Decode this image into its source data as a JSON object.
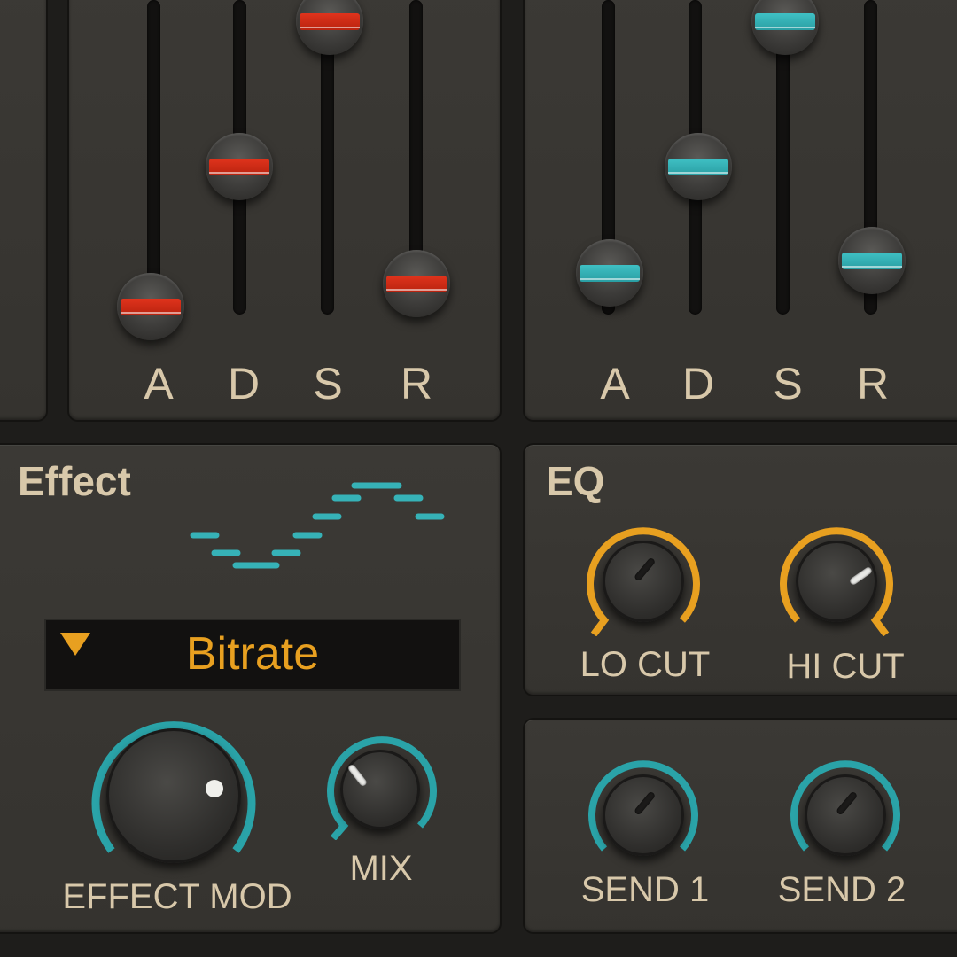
{
  "accent": {
    "env1": "#d9301a",
    "env2": "#36b2b7",
    "eq": "#e8a020",
    "effect_knob": "#2aa3a8"
  },
  "envelope_left": {
    "labels": [
      "A",
      "D",
      "S",
      "R"
    ]
  },
  "envelope_right": {
    "labels": [
      "A",
      "D",
      "S",
      "R"
    ]
  },
  "effect": {
    "title": "Effect",
    "type_value": "Bitrate",
    "dropdown_icon": "triangle-down-icon",
    "waveform_icon": "stepped-sine-icon",
    "knob_effect_mod_label": "EFFECT MOD",
    "knob_mix_label": "MIX"
  },
  "eq": {
    "title": "EQ",
    "lo_cut_label": "LO CUT",
    "hi_cut_label": "HI CUT"
  },
  "sends": {
    "send1_label": "SEND 1",
    "send2_label": "SEND 2"
  }
}
